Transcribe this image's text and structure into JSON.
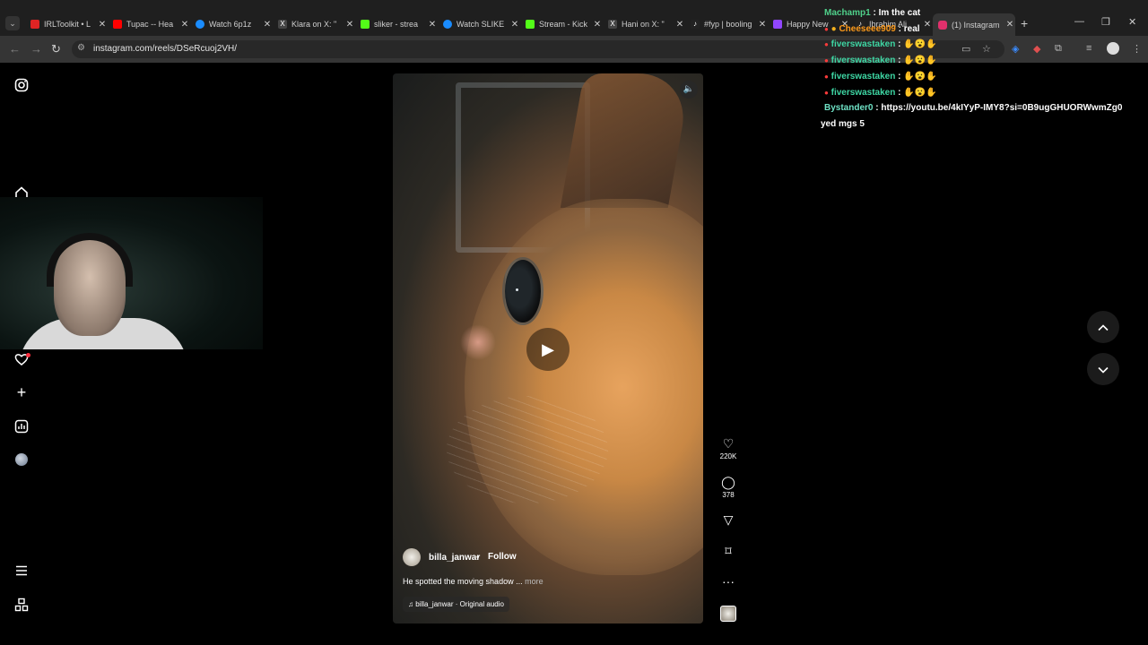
{
  "browser": {
    "tabs": [
      {
        "title": "IRLToolkit • L",
        "color": "#e02424"
      },
      {
        "title": "Tupac -- Hea",
        "color": "#ff0000"
      },
      {
        "title": "Watch 6p1z",
        "color": "#1a8cff"
      },
      {
        "title": "Klara on X: \"",
        "color": "#ffffff"
      },
      {
        "title": "sliker - strea",
        "color": "#53fc18"
      },
      {
        "title": "Watch SLIKE",
        "color": "#1a8cff"
      },
      {
        "title": "Stream - Kick",
        "color": "#53fc18"
      },
      {
        "title": "Hani on X: \"",
        "color": "#ffffff"
      },
      {
        "title": "#fyp | booling",
        "color": "#ffffff"
      },
      {
        "title": "Happy New",
        "color": "#9146ff"
      },
      {
        "title": "Ibrahim Ali",
        "color": "#ffffff"
      },
      {
        "title": "(1) Instagram",
        "color": "#e1306c"
      }
    ],
    "url": "instagram.com/reels/DSeRcuoj2VH/"
  },
  "reel": {
    "username": "billa_janwar",
    "separator": "•",
    "follow_label": "Follow",
    "caption": "He spotted the moving shadow ...",
    "more_label": "more",
    "audio": "billa_janwar · Original audio",
    "likes": "220K",
    "comments": "378"
  },
  "chat": [
    {
      "name": "Machamp1",
      "sep": " : ",
      "msg": "Im the cat"
    },
    {
      "name": "Cheeseee909",
      "sep": " : ",
      "msg": "real"
    },
    {
      "name": "fiverswastaken",
      "sep": " : ",
      "msg": "✋😮✋"
    },
    {
      "name": "fiverswastaken",
      "sep": " : ",
      "msg": "✋😮✋"
    },
    {
      "name": "fiverswastaken",
      "sep": " : ",
      "msg": "✋😮✋"
    },
    {
      "name": "fiverswastaken",
      "sep": " : ",
      "msg": "✋😮✋"
    },
    {
      "name": "Bystander0",
      "sep": " : ",
      "msg": "https://youtu.be/4kIYyP-IMY8?si=0B9ugGHUORWwmZg0"
    },
    {
      "name": "",
      "sep": "",
      "msg": "yed mgs 5"
    }
  ],
  "icons": {
    "instagram": "instagram-icon",
    "home": "home-icon",
    "heart": "heart-icon",
    "create": "plus-icon",
    "dashboard": "dashboard-icon",
    "menu": "menu-icon",
    "more": "apps-icon"
  }
}
